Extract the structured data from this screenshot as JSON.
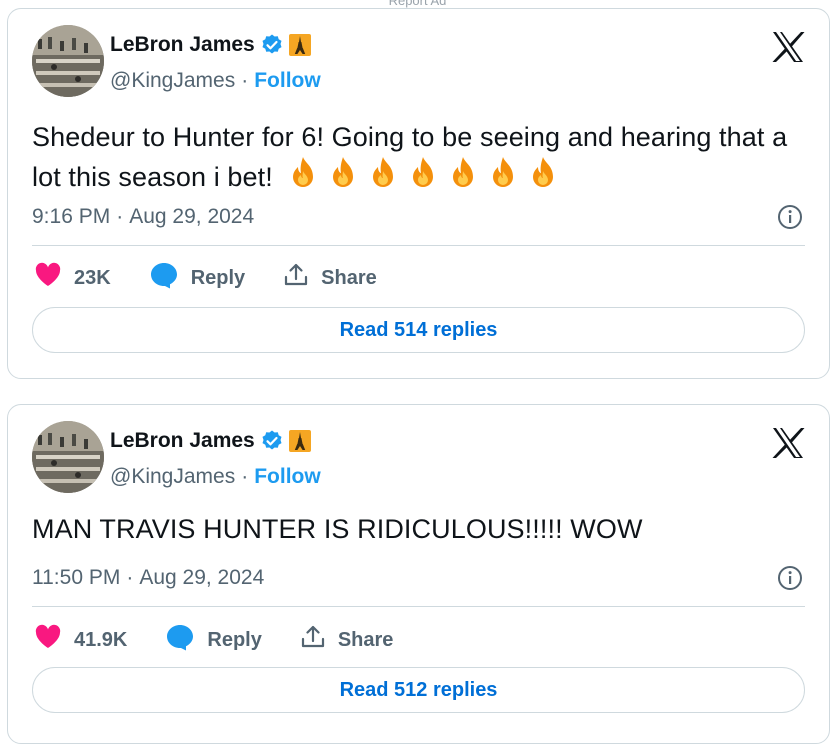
{
  "top_note": "Report Ad",
  "colors": {
    "blue": "#1d9bf0",
    "like": "#f91880",
    "read_link": "#006fd6",
    "secondary_text": "#536471"
  },
  "tweets": [
    {
      "author_name": "LeBron James",
      "handle": "@KingJames",
      "separator": "·",
      "follow_label": "Follow",
      "text": "Shedeur to Hunter for 6! Going to be seeing and hearing that a lot this season i bet!",
      "emoji_count": 7,
      "time": "9:16 PM",
      "date": "Aug 29, 2024",
      "likes": "23K",
      "reply_label": "Reply",
      "share_label": "Share",
      "read_replies_label": "Read 514 replies",
      "icons": [
        "verified-badge-icon",
        "eiffel-tower-icon",
        "x-logo-icon",
        "fire-icon",
        "info-icon",
        "heart-icon",
        "reply-bubble-icon",
        "share-icon"
      ]
    },
    {
      "author_name": "LeBron James",
      "handle": "@KingJames",
      "separator": "·",
      "follow_label": "Follow",
      "text": "MAN TRAVIS HUNTER IS RIDICULOUS!!!!! WOW",
      "time": "11:50 PM",
      "date": "Aug 29, 2024",
      "likes": "41.9K",
      "reply_label": "Reply",
      "share_label": "Share",
      "read_replies_label": "Read 512 replies",
      "icons": [
        "verified-badge-icon",
        "eiffel-tower-icon",
        "x-logo-icon",
        "info-icon",
        "heart-icon",
        "reply-bubble-icon",
        "share-icon"
      ]
    }
  ]
}
